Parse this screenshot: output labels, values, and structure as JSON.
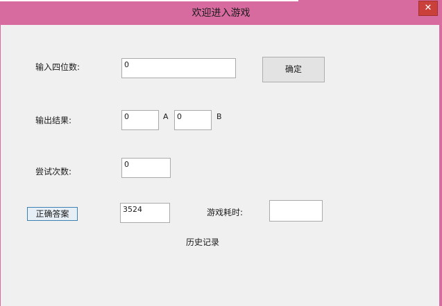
{
  "window": {
    "title": "欢迎进入游戏",
    "close_glyph": "✕",
    "accent_color": "#d76ba0",
    "close_color": "#c9413a"
  },
  "form": {
    "guess_label": "输入四位数:",
    "guess_value": "0",
    "confirm_label": "确定",
    "result_label": "输出结果:",
    "a_value": "0",
    "a_unit": "A",
    "b_value": "0",
    "b_unit": "B",
    "attempts_label": "尝试次数:",
    "attempts_value": "0",
    "answer_button_label": "正确答案",
    "answer_value": "3524",
    "time_label": "游戏耗时:",
    "time_value": "",
    "history_label": "历史记录"
  }
}
